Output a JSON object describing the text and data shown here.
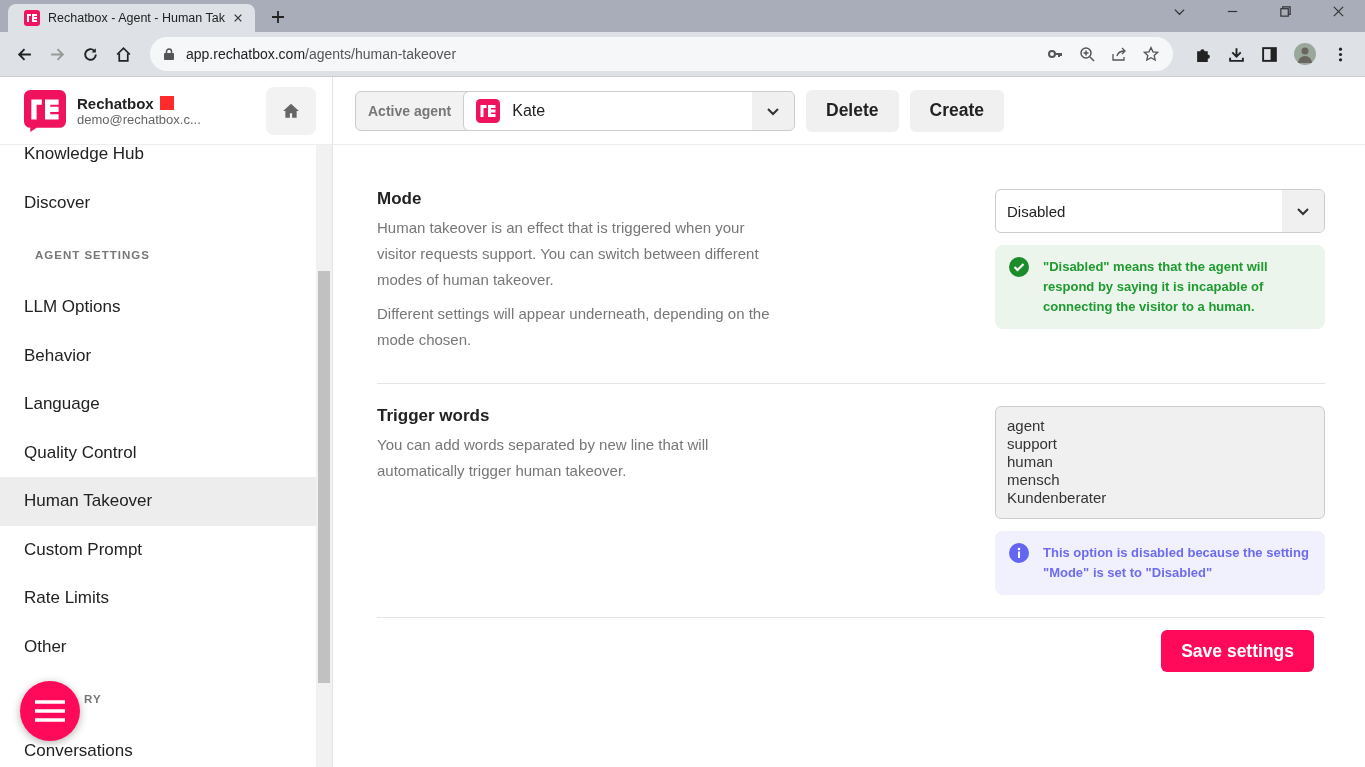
{
  "browser": {
    "tab_title": "Rechatbox - Agent - Human Tak",
    "url_host": "app.rechatbox.com",
    "url_path": "/agents/human-takeover"
  },
  "sidebar": {
    "brand": "Rechatbox",
    "account": "demo@rechatbox.c...",
    "items": [
      {
        "kind": "item",
        "label": "Knowledge Hub",
        "selected": false
      },
      {
        "kind": "item",
        "label": "Discover",
        "selected": false
      },
      {
        "kind": "section",
        "label": "AGENT SETTINGS"
      },
      {
        "kind": "item",
        "label": "LLM Options",
        "selected": false
      },
      {
        "kind": "item",
        "label": "Behavior",
        "selected": false
      },
      {
        "kind": "item",
        "label": "Language",
        "selected": false
      },
      {
        "kind": "item",
        "label": "Quality Control",
        "selected": false
      },
      {
        "kind": "item",
        "label": "Human Takeover",
        "selected": true
      },
      {
        "kind": "item",
        "label": "Custom Prompt",
        "selected": false
      },
      {
        "kind": "item",
        "label": "Rate Limits",
        "selected": false
      },
      {
        "kind": "item",
        "label": "Other",
        "selected": false
      },
      {
        "kind": "section",
        "label": "RY",
        "partly_covered": true
      },
      {
        "kind": "item",
        "label": "Conversations",
        "selected": false
      }
    ]
  },
  "header": {
    "agent_label": "Active agent",
    "agent": "Kate",
    "buttons": [
      "Delete",
      "Create"
    ]
  },
  "settings": [
    {
      "title": "Mode",
      "paragraphs": [
        "Human takeover is an effect that is triggered when your visitor requests support. You can switch between different modes of human takeover.",
        "Different settings will appear underneath, depending on the mode chosen."
      ],
      "control": {
        "kind": "select",
        "value": "Disabled"
      },
      "note": {
        "kind": "success",
        "text": "\"Disabled\" means that the agent will respond by saying it is incapable of connecting the visitor to a human."
      }
    },
    {
      "title": "Trigger words",
      "paragraphs": [
        "You can add words separated by new line that will automatically trigger human takeover."
      ],
      "control": {
        "kind": "textarea",
        "value": "agent\nsupport\nhuman\nmensch\nKundenberater",
        "disabled": true
      },
      "note": {
        "kind": "info",
        "text": "This option is disabled because the setting \"Mode\" is set to \"Disabled\""
      }
    }
  ],
  "save_button": "Save settings"
}
